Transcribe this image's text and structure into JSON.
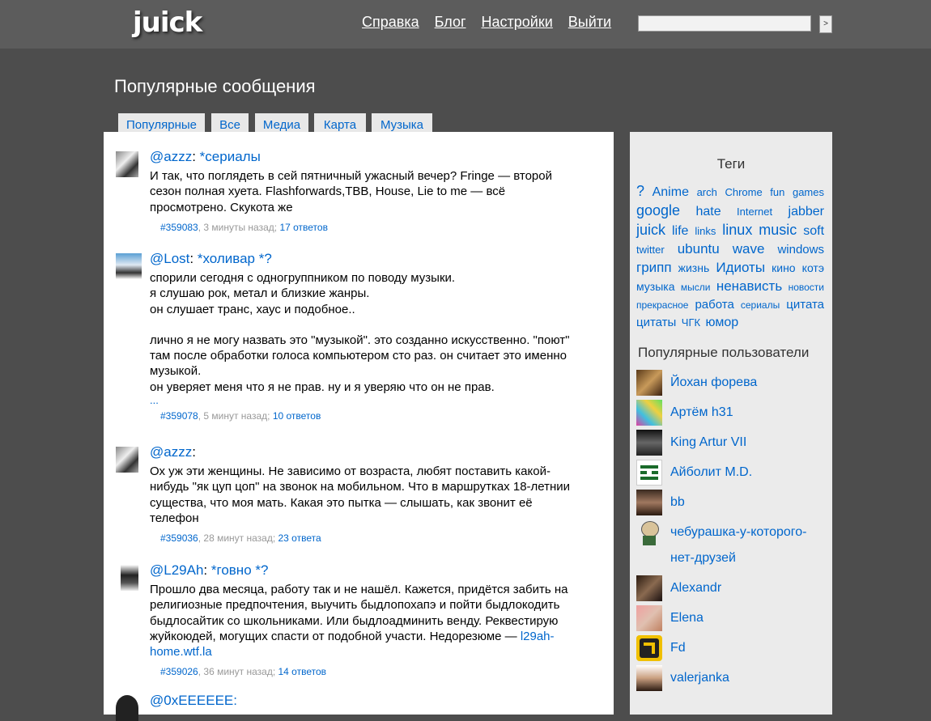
{
  "header": {
    "logo": "juick",
    "nav": [
      "Справка",
      "Блог",
      "Настройки",
      "Выйти"
    ],
    "search_placeholder": "",
    "search_button": ">"
  },
  "page_title": "Популярные сообщения",
  "tabs": [
    "Популярные",
    "Все",
    "Медиа",
    "Карта",
    "Музыка"
  ],
  "messages": [
    {
      "user": "@azzz",
      "tags": "*сериалы",
      "lines": [
        "И так, что поглядеть в сей пятничный ужасный вечер? Fringe — второй",
        "сезон полная хуета. Flashforwards,TBB, House, Lie to me — всё",
        "просмотрено. Скукота же"
      ],
      "id": "#359083",
      "time": "3 минуты назад",
      "replies": "17 ответов"
    },
    {
      "user": "@Lost",
      "tags": "*холивар *?",
      "lines": [
        "спорили сегодня с одногруппником по поводу музыки.",
        "я слушаю рок, метал и близкие жанры.",
        "он слушает транс, хаус и подобное..",
        "",
        "лично я не могу назвать это \"музыкой\". это созданно искусственно. \"поют\"",
        "там после обработки голоса компьютером сто раз. он считает это именно",
        "музыкой.",
        "он уверяет меня что я не прав. ну и я уверяю что он не прав."
      ],
      "more": "...",
      "id": "#359078",
      "time": "5 минут назад",
      "replies": "10 ответов"
    },
    {
      "user": "@azzz",
      "tags": "",
      "lines": [
        "Ох уж эти женщины. Не зависимо от возраста, любят поставить какой-",
        "нибудь \"як цуп цоп\" на звонок на мобильном. Что в маршрутках 18-летнии",
        "существа, что моя мать. Какая это пытка — слышать, как звонит её",
        "телефон"
      ],
      "id": "#359036",
      "time": "28 минут назад",
      "replies": "23 ответа"
    },
    {
      "user": "@L29Ah",
      "tags": "*говно *?",
      "lines": [
        "Прошло два месяца, работу так и не нашёл. Кажется, придётся забить на",
        "религиозные предпочтения, выучить быдлопохапэ и пойти быдлокодить",
        "быдлосайтик со школьниками. Или быдлоадминить венду. Реквестирую",
        "жуйкоюдей, могущих спасти от подобной участи. Недорезюме — "
      ],
      "link": "l29ah-home.wtf.la",
      "link_parts": [
        "l29ah-",
        "home.wtf.la"
      ],
      "id": "#359026",
      "time": "36 минут назад",
      "replies": "14 ответов"
    },
    {
      "user": "@0xEEEEEE:",
      "tags": "",
      "lines": [],
      "id": "",
      "time": "",
      "replies": ""
    }
  ],
  "sidebar": {
    "tags_title": "Теги",
    "tags": [
      {
        "label": "?",
        "size": 18
      },
      {
        "label": "Anime",
        "size": 16
      },
      {
        "label": "arch",
        "size": 13
      },
      {
        "label": "Chrome",
        "size": 13
      },
      {
        "label": "fun",
        "size": 13
      },
      {
        "label": "games",
        "size": 13
      },
      {
        "label": "google",
        "size": 18
      },
      {
        "label": "hate",
        "size": 16
      },
      {
        "label": "Internet",
        "size": 13
      },
      {
        "label": "jabber",
        "size": 16
      },
      {
        "label": "juick",
        "size": 18
      },
      {
        "label": "life",
        "size": 16
      },
      {
        "label": "links",
        "size": 13
      },
      {
        "label": "linux",
        "size": 18
      },
      {
        "label": "music",
        "size": 18
      },
      {
        "label": "soft",
        "size": 16
      },
      {
        "label": "twitter",
        "size": 13
      },
      {
        "label": "ubuntu",
        "size": 17
      },
      {
        "label": "wave",
        "size": 17
      },
      {
        "label": "windows",
        "size": 15
      },
      {
        "label": "грипп",
        "size": 17
      },
      {
        "label": "жизнь",
        "size": 14
      },
      {
        "label": "Идиоты",
        "size": 17
      },
      {
        "label": "кино",
        "size": 14
      },
      {
        "label": "котэ",
        "size": 14
      },
      {
        "label": "музыка",
        "size": 14
      },
      {
        "label": "мысли",
        "size": 12
      },
      {
        "label": "ненависть",
        "size": 17
      },
      {
        "label": "новости",
        "size": 12
      },
      {
        "label": "прекрасное",
        "size": 12
      },
      {
        "label": "работа",
        "size": 15
      },
      {
        "label": "сериалы",
        "size": 12
      },
      {
        "label": "цитата",
        "size": 15
      },
      {
        "label": "цитаты",
        "size": 15
      },
      {
        "label": "ЧГК",
        "size": 13
      },
      {
        "label": "юмор",
        "size": 16
      }
    ],
    "users_title": "Популярные пользователи",
    "users": [
      {
        "name": "Йохан форева"
      },
      {
        "name": "Артём h31"
      },
      {
        "name": "King Artur VII"
      },
      {
        "name": "Айболит M.D."
      },
      {
        "name": "bb"
      },
      {
        "name": "чебурашка-у-которого-",
        "name2": "нет-друзей"
      },
      {
        "name": "Alexandr"
      },
      {
        "name": "Elena"
      },
      {
        "name": "Fd"
      },
      {
        "name": "valerjanka"
      }
    ]
  },
  "colors": {
    "background": "#4d4d4d",
    "header": "#5c5c5c",
    "link": "#0066cc",
    "sidebar": "#ebebeb"
  }
}
